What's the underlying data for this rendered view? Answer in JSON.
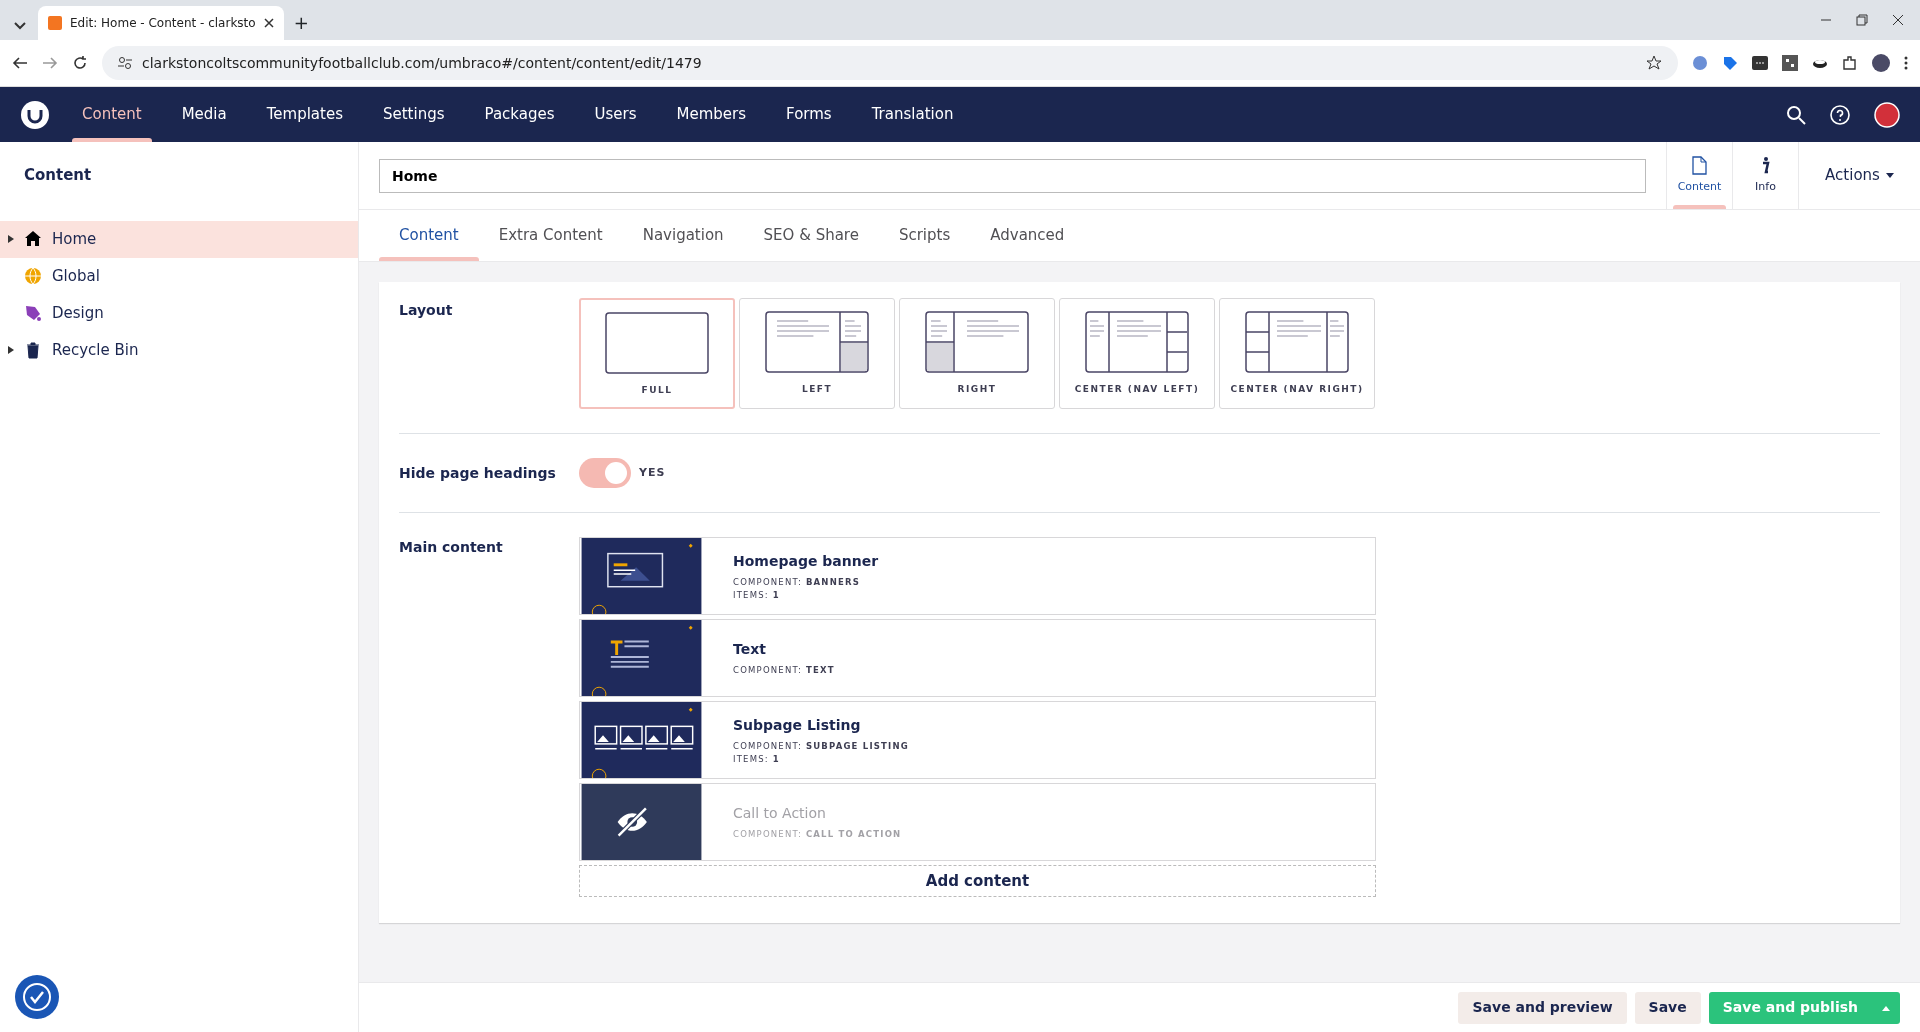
{
  "browser": {
    "tab_title": "Edit: Home - Content - clarksto",
    "new_tab": "+",
    "url": "clarkstoncoltscommunityfootballclub.com/umbraco#/content/content/edit/1479"
  },
  "header": {
    "sections": [
      {
        "label": "Content",
        "selected": true
      },
      {
        "label": "Media",
        "selected": false
      },
      {
        "label": "Templates",
        "selected": false
      },
      {
        "label": "Settings",
        "selected": false
      },
      {
        "label": "Packages",
        "selected": false
      },
      {
        "label": "Users",
        "selected": false
      },
      {
        "label": "Members",
        "selected": false
      },
      {
        "label": "Forms",
        "selected": false
      },
      {
        "label": "Translation",
        "selected": false
      }
    ]
  },
  "sidebar": {
    "title": "Content",
    "items": [
      {
        "label": "Home",
        "kind": "home",
        "selected": true,
        "has_children": true
      },
      {
        "label": "Global",
        "kind": "globe",
        "selected": false,
        "has_children": false
      },
      {
        "label": "Design",
        "kind": "paint",
        "selected": false,
        "has_children": false
      },
      {
        "label": "Recycle Bin",
        "kind": "bin",
        "selected": false,
        "has_children": true
      }
    ]
  },
  "editor": {
    "name": "Home",
    "apps": [
      {
        "label": "Content",
        "kind": "document",
        "selected": true
      },
      {
        "label": "Info",
        "kind": "info",
        "selected": false
      }
    ],
    "actions": "Actions",
    "tabs": [
      {
        "label": "Content",
        "selected": true
      },
      {
        "label": "Extra Content",
        "selected": false
      },
      {
        "label": "Navigation",
        "selected": false
      },
      {
        "label": "SEO & Share",
        "selected": false
      },
      {
        "label": "Scripts",
        "selected": false
      },
      {
        "label": "Advanced",
        "selected": false
      }
    ]
  },
  "properties": {
    "layout": {
      "label": "Layout",
      "options": [
        {
          "label": "FULL",
          "kind": "full",
          "selected": true
        },
        {
          "label": "LEFT",
          "kind": "left",
          "selected": false
        },
        {
          "label": "RIGHT",
          "kind": "right",
          "selected": false
        },
        {
          "label": "CENTER (NAV LEFT)",
          "kind": "center-left",
          "selected": false
        },
        {
          "label": "CENTER (NAV RIGHT)",
          "kind": "center-right",
          "selected": false
        }
      ]
    },
    "hide_headings": {
      "label": "Hide page headings",
      "on": true,
      "value": "YES"
    },
    "main_content": {
      "label": "Main content",
      "items": [
        {
          "title": "Homepage banner",
          "kind": "banner",
          "hidden": false,
          "meta": [
            {
              "key": "COMPONENT:",
              "value": "BANNERS"
            },
            {
              "key": "ITEMS:",
              "value": "1"
            }
          ]
        },
        {
          "title": "Text",
          "kind": "text",
          "hidden": false,
          "meta": [
            {
              "key": "COMPONENT:",
              "value": "TEXT"
            }
          ]
        },
        {
          "title": "Subpage Listing",
          "kind": "listing",
          "hidden": false,
          "meta": [
            {
              "key": "COMPONENT:",
              "value": "SUBPAGE LISTING"
            },
            {
              "key": "ITEMS:",
              "value": "1"
            }
          ]
        },
        {
          "title": "Call to Action",
          "kind": "cta",
          "hidden": true,
          "meta": [
            {
              "key": "COMPONENT:",
              "value": "CALL TO ACTION"
            }
          ]
        }
      ],
      "add": "Add content"
    }
  },
  "footer": {
    "buttons": [
      {
        "label": "Save and preview",
        "kind": "secondary"
      },
      {
        "label": "Save",
        "kind": "secondary"
      },
      {
        "label": "Save and publish",
        "kind": "primary"
      }
    ]
  }
}
